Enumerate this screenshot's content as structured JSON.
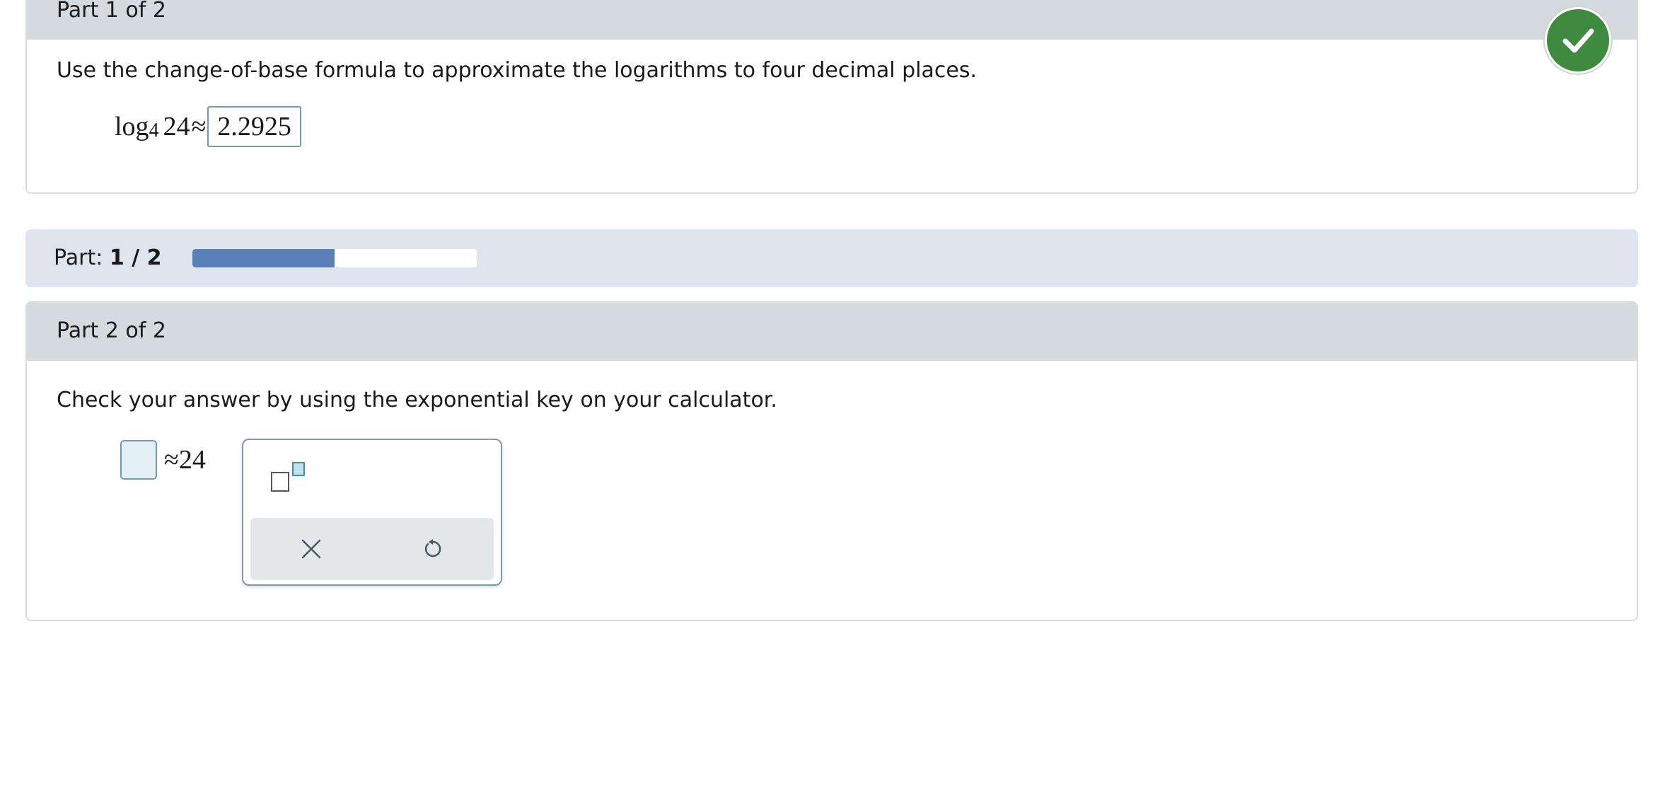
{
  "part1": {
    "header": "Part 1 of 2",
    "instruction": "Use the change-of-base formula to approximate the logarithms to four decimal places.",
    "math": {
      "log": "log",
      "base": "4",
      "argument": "24",
      "approx": "≈",
      "answer": "2.2925"
    },
    "status": "correct",
    "colors": {
      "check": "#3e8a3e"
    }
  },
  "progress": {
    "label": "Part:",
    "current": "1 / 2",
    "fraction": 0.5,
    "colors": {
      "fill": "#5a80b8",
      "track": "#ffffff",
      "background": "#dfe5ee"
    }
  },
  "part2": {
    "header": "Part 2 of 2",
    "instruction": "Check your answer by using the exponential key on your calculator.",
    "math": {
      "input_value": "",
      "approx": "≈",
      "value": "24"
    },
    "palette": {
      "keys": [
        {
          "icon": "exponent-template-icon"
        }
      ],
      "actions": [
        {
          "icon": "close-icon"
        },
        {
          "icon": "undo-icon"
        }
      ]
    }
  }
}
